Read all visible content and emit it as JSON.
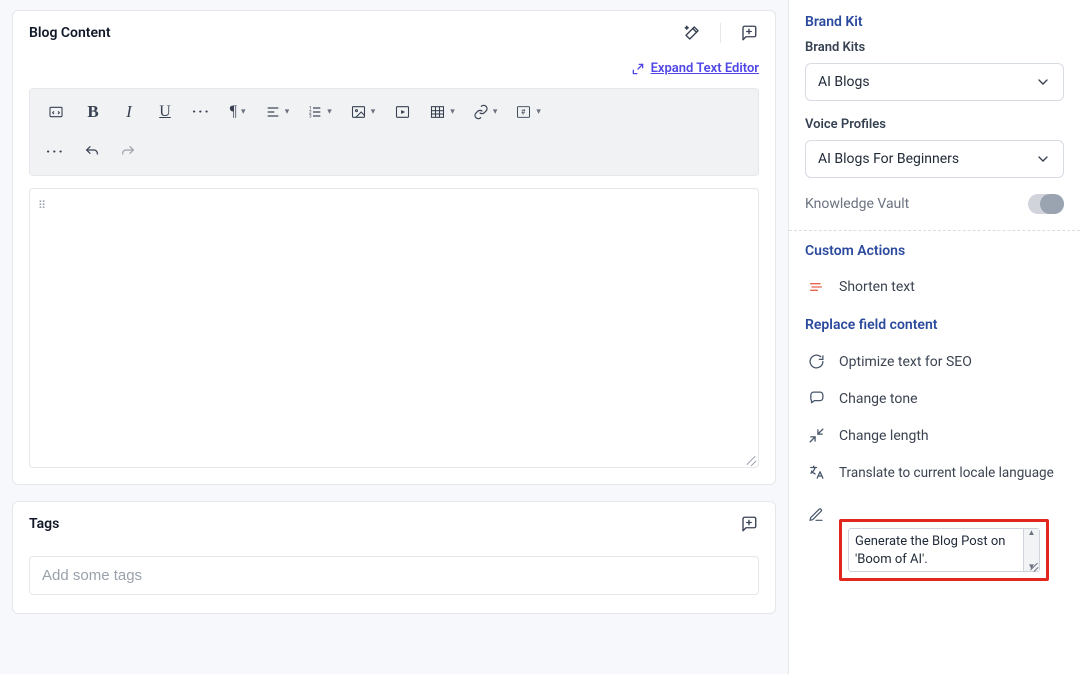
{
  "blogContent": {
    "title": "Blog Content",
    "expandLabel": "Expand Text Editor"
  },
  "tags": {
    "title": "Tags",
    "placeholder": "Add some tags"
  },
  "sidebar": {
    "brandKit": {
      "heading": "Brand Kit",
      "brandKitsLabel": "Brand Kits",
      "brandKitsValue": "AI Blogs",
      "voiceLabel": "Voice Profiles",
      "voiceValue": "AI Blogs For Beginners",
      "knowledgeVault": "Knowledge Vault"
    },
    "customActions": {
      "heading": "Custom Actions",
      "shorten": "Shorten text"
    },
    "replace": {
      "heading": "Replace field content",
      "optimize": "Optimize text for SEO",
      "tone": "Change tone",
      "length": "Change length",
      "translate": "Translate to current locale language",
      "promptValue": "Generate the Blog Post on 'Boom of AI'."
    }
  }
}
